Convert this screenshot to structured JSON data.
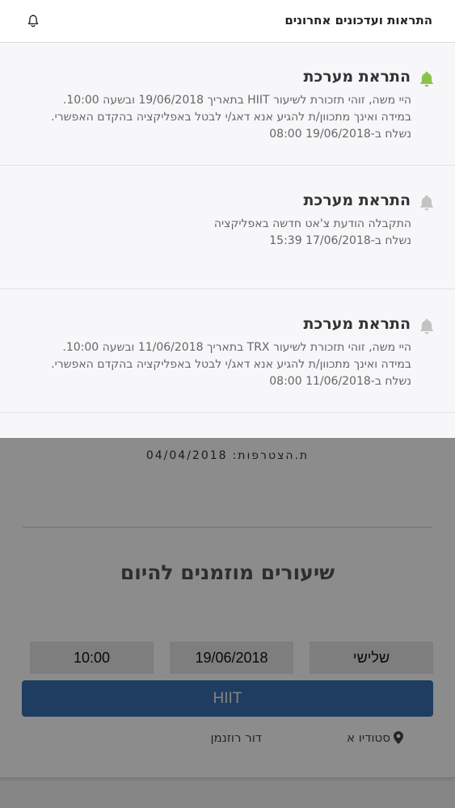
{
  "background": {
    "join_date_label": "ת.הצטרפות:",
    "join_date_value": "04/04/2018",
    "classes_title": "שיעורים מוזמנים להיום",
    "class": {
      "day": "שלישי",
      "date": "19/06/2018",
      "time": "10:00",
      "name": "HIIT",
      "studio": "סטודיו א",
      "trainer": "דור רוזנמן"
    }
  },
  "notifications_panel": {
    "title": "התראות ועדכונים אחרונים",
    "items": [
      {
        "title": "התראת מערכת",
        "line1": "היי משה, זוהי תזכורת לשיעור HIIT בתאריך 19/06/2018 ובשעה 10:00.",
        "line2": "במידה ואינך מתכוון/ת להגיע אנא דאג/י לבטל באפליקציה בהקדם האפשרי.",
        "sent": "נשלח ב-19/06/2018 08:00",
        "bell_color": "#8bc34a"
      },
      {
        "title": "התראת מערכת",
        "line1": "התקבלה הודעת צ'אט חדשה באפליקציה",
        "line2": "",
        "sent": "נשלח ב-17/06/2018 15:39",
        "bell_color": "#c3c3c3"
      },
      {
        "title": "התראת מערכת",
        "line1": "היי משה, זוהי תזכורת לשיעור TRX בתאריך 11/06/2018 ובשעה 10:00.",
        "line2": "במידה ואינך מתכוון/ת להגיע אנא דאג/י לבטל באפליקציה בהקדם האפשרי.",
        "sent": "נשלח ב-11/06/2018 08:00",
        "bell_color": "#c3c3c3"
      }
    ]
  },
  "colors": {
    "accent": "#3a6fb0",
    "unread_bell": "#8bc34a",
    "read_bell": "#c3c3c3"
  }
}
